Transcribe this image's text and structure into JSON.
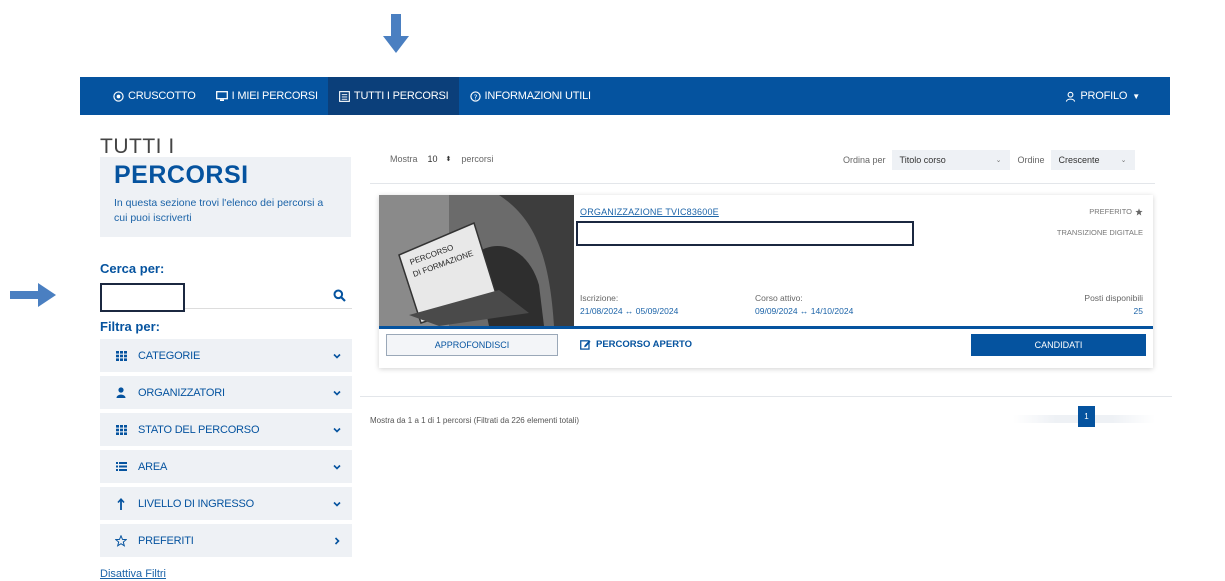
{
  "nav": {
    "items": [
      {
        "label": "CRUSCOTTO",
        "icon": "dashboard-icon"
      },
      {
        "label": "I MIEI PERCORSI",
        "icon": "monitor-icon"
      },
      {
        "label": "TUTTI I PERCORSI",
        "icon": "list-icon",
        "active": true
      },
      {
        "label": "INFORMAZIONI UTILI",
        "icon": "help-icon"
      }
    ],
    "profile_label": "PROFILO",
    "colors": {
      "bar": "#05539f",
      "active": "#0b3f7a"
    }
  },
  "header": {
    "title_line1": "TUTTI I",
    "title_line2": "PERCORSI",
    "intro": "In questa sezione trovi l'elenco dei percorsi a cui puoi iscriverti"
  },
  "search": {
    "label": "Cerca per:",
    "value": "",
    "icon": "search-icon"
  },
  "filters": {
    "label": "Filtra per:",
    "items": [
      {
        "label": "CATEGORIE",
        "icon": "grid-icon",
        "chevron": "chevron-down-icon"
      },
      {
        "label": "ORGANIZZATORI",
        "icon": "user-icon",
        "chevron": "chevron-down-icon"
      },
      {
        "label": "STATO DEL PERCORSO",
        "icon": "grid-icon",
        "chevron": "chevron-down-icon"
      },
      {
        "label": "AREA",
        "icon": "list-icon",
        "chevron": "chevron-down-icon"
      },
      {
        "label": "LIVELLO DI INGRESSO",
        "icon": "arrow-up-icon",
        "chevron": "chevron-down-icon"
      },
      {
        "label": "PREFERITI",
        "icon": "star-outline-icon",
        "chevron": "chevron-right-icon"
      }
    ],
    "disable_label": "Disattiva Filtri"
  },
  "list_controls": {
    "show_label": "Mostra",
    "show_value": "10",
    "show_suffix": "percorsi",
    "sort_label": "Ordina per",
    "sort_value": "Titolo corso",
    "order_label": "Ordine",
    "order_value": "Crescente"
  },
  "course": {
    "image_text": "PERCORSO\nDI FORMAZIONE",
    "image_line1": "PERCORSO",
    "image_line2": "DI FORMAZIONE",
    "organization": "ORGANIZZAZIONE TVIC83600E",
    "title": "",
    "favorite_label": "PREFERITO",
    "area": "TRANSIZIONE DIGITALE",
    "enrollment_label": "Iscrizione:",
    "enrollment_dates": "21/08/2024 ↔ 05/09/2024",
    "active_label": "Corso attivo:",
    "active_dates": "09/09/2024 ↔ 14/10/2024",
    "seats_label": "Posti disponibili",
    "seats_value": "25",
    "details_button": "APPROFONDISCI",
    "status": "PERCORSO APERTO",
    "apply_button": "CANDIDATI"
  },
  "footer": {
    "summary": "Mostra da 1 a 1 di 1 percorsi (Filtrati da 226 elementi totali)",
    "page": "1"
  },
  "annotations": {
    "color": "#4a7fc1"
  }
}
